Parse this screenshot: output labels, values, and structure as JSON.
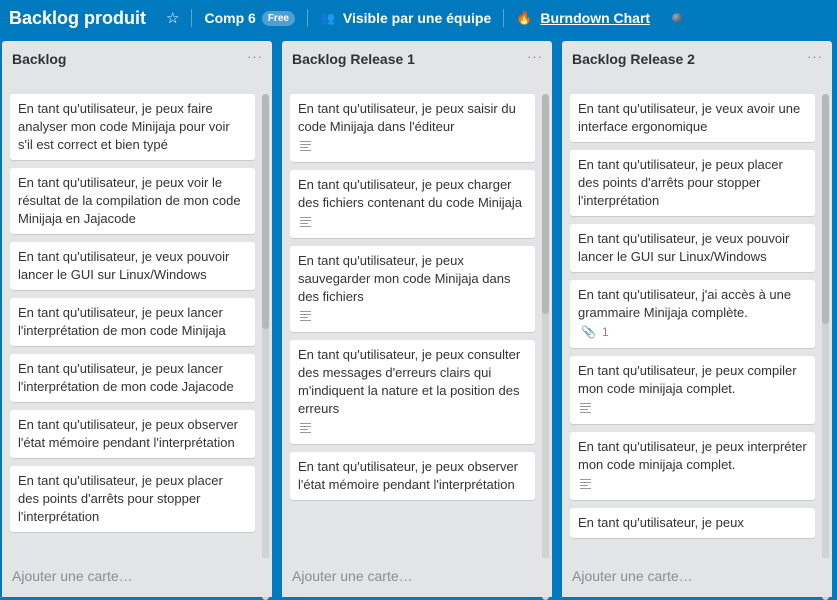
{
  "header": {
    "board_title": "Backlog produit",
    "team": "Comp 6",
    "team_badge": "Free",
    "visibility": "Visible par une équipe",
    "powerup": "Burndown Chart"
  },
  "lists": [
    {
      "title": "Backlog",
      "menu": "···",
      "add_card": "Ajouter une carte…",
      "cards": [
        {
          "text": "En tant qu'utilisateur, je peux faire analyser mon code Minijaja pour voir s'il est correct et bien typé"
        },
        {
          "text": "En tant qu'utilisateur, je peux voir le résultat de la compilation de mon code Minijaja en Jajacode"
        },
        {
          "text": "En tant qu'utilisateur, je veux pouvoir lancer le GUI sur Linux/Windows"
        },
        {
          "text": "En tant qu'utilisateur, je peux lancer l'interprétation de mon code Minijaja"
        },
        {
          "text": "En tant qu'utilisateur, je peux lancer l'interprétation de mon code Jajacode"
        },
        {
          "text": "En tant qu'utilisateur, je peux observer l'état mémoire pendant l'interprétation"
        },
        {
          "text": "En tant qu'utilisateur, je peux placer des points d'arrêts pour stopper l'interprétation"
        }
      ]
    },
    {
      "title": "Backlog Release 1",
      "menu": "···",
      "add_card": "Ajouter une carte…",
      "cards": [
        {
          "text": "En tant qu'utilisateur, je peux saisir du code Minijaja dans l'éditeur"
        },
        {
          "text": "En tant qu'utilisateur, je peux charger des fichiers contenant du code Minijaja"
        },
        {
          "text": "En tant qu'utilisateur, je peux sauvegarder mon code Minijaja dans des fichiers"
        },
        {
          "text": "En tant qu'utilisateur, je peux consulter des messages d'erreurs clairs qui m'indiquent la nature et la position des erreurs"
        },
        {
          "text": "En tant qu'utilisateur, je peux observer l'état mémoire pendant l'interprétation"
        }
      ]
    },
    {
      "title": "Backlog Release 2",
      "menu": "···",
      "add_card": "Ajouter une carte…",
      "cards": [
        {
          "text": "En tant qu'utilisateur, je veux avoir une interface ergonomique"
        },
        {
          "text": "En tant qu'utilisateur, je peux placer des points d'arrêts pour stopper l'interprétation"
        },
        {
          "text": "En tant qu'utilisateur, je veux pouvoir lancer le GUI sur Linux/Windows"
        },
        {
          "text": "En tant qu'utilisateur, j'ai accès à une grammaire Minijaja complète.",
          "attachments": "1"
        },
        {
          "text": "En tant qu'utilisateur, je peux compiler mon code minijaja complet."
        },
        {
          "text": "En tant qu'utilisateur, je peux interpréter mon code minijaja complet."
        },
        {
          "text": "En tant qu'utilisateur, je peux"
        }
      ]
    }
  ]
}
